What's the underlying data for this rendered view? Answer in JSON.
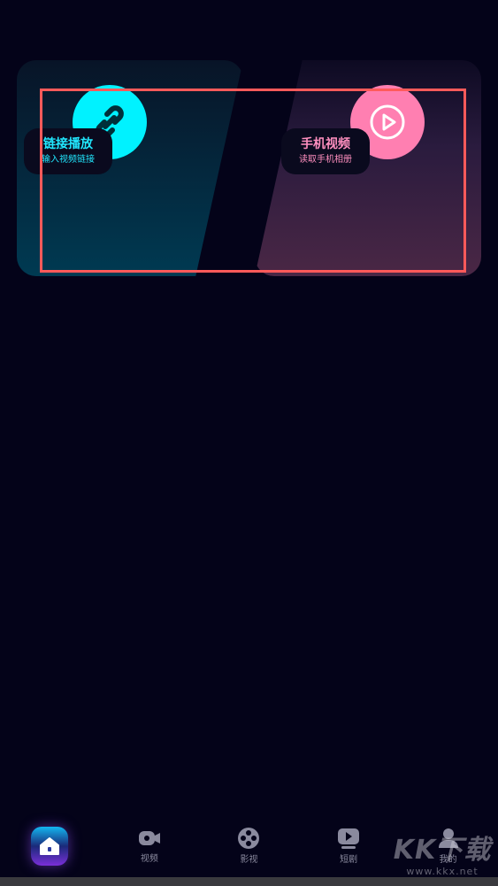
{
  "cards": {
    "link": {
      "title": "链接播放",
      "subtitle": "输入视频链接",
      "icon": "link-icon",
      "color": "#00f2ff"
    },
    "local": {
      "title": "手机视频",
      "subtitle": "读取手机相册",
      "icon": "play-circle-icon",
      "color": "#ff7fb1"
    }
  },
  "tabbar": {
    "items": [
      {
        "label": "",
        "icon": "home-icon"
      },
      {
        "label": "视频",
        "icon": "video-camera-icon"
      },
      {
        "label": "影视",
        "icon": "film-reel-icon"
      },
      {
        "label": "短剧",
        "icon": "play-box-icon"
      },
      {
        "label": "我的",
        "icon": "user-icon"
      }
    ]
  },
  "watermark": {
    "big": "KK下载",
    "small": "www.kkx.net"
  },
  "colors": {
    "background": "#040319",
    "highlight": "#ff5a5a"
  }
}
